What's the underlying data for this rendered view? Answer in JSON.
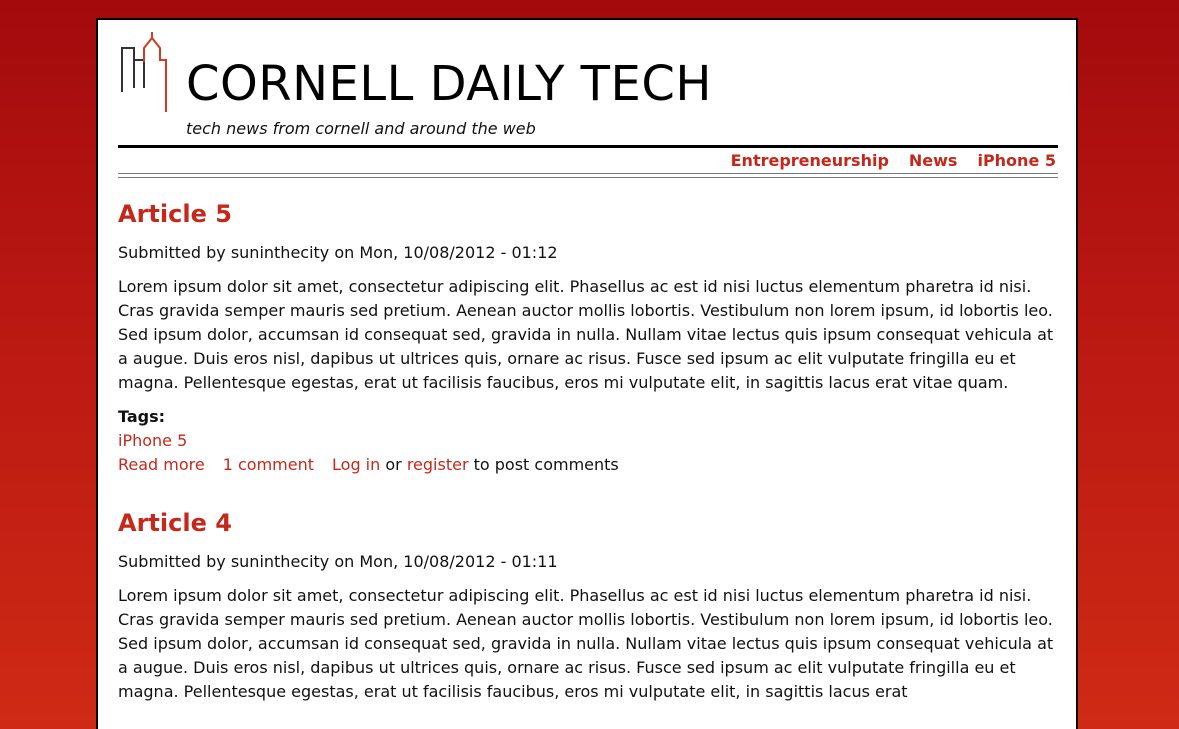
{
  "site": {
    "title": "CORNELL DAILY TECH",
    "slogan": "tech news from cornell and around the web",
    "logo_icon": "city-skyline-logo-icon"
  },
  "nav": {
    "items": [
      {
        "label": "Entrepreneurship"
      },
      {
        "label": "News"
      },
      {
        "label": "iPhone 5"
      }
    ]
  },
  "colors": {
    "accent": "#c5281a",
    "background_top": "#a30a0c",
    "background_bottom": "#cf2a15"
  },
  "articles": [
    {
      "title": "Article 5",
      "submitted": "Submitted by suninthecity on Mon, 10/08/2012 - 01:12",
      "body": "Lorem ipsum dolor sit amet, consectetur adipiscing elit. Phasellus ac est id nisi luctus elementum pharetra id nisi. Cras gravida semper mauris sed pretium. Aenean auctor mollis lobortis. Vestibulum non lorem ipsum, id lobortis leo. Sed ipsum dolor, accumsan id consequat sed, gravida in nulla. Nullam vitae lectus quis ipsum consequat vehicula at a augue. Duis eros nisl, dapibus ut ultrices quis, ornare ac risus. Fusce sed ipsum ac elit vulputate fringilla eu et magna. Pellentesque egestas, erat ut facilisis faucibus, eros mi vulputate elit, in sagittis lacus erat vitae quam.",
      "tags_label": "Tags:",
      "tag": "iPhone 5",
      "read_more": "Read more",
      "comments": "1 comment",
      "login": "Log in",
      "or_text": "or",
      "register": "register",
      "post_text": "to post comments"
    },
    {
      "title": "Article 4",
      "submitted": "Submitted by suninthecity on Mon, 10/08/2012 - 01:11",
      "body": "Lorem ipsum dolor sit amet, consectetur adipiscing elit. Phasellus ac est id nisi luctus elementum pharetra id nisi. Cras gravida semper mauris sed pretium. Aenean auctor mollis lobortis. Vestibulum non lorem ipsum, id lobortis leo. Sed ipsum dolor, accumsan id consequat sed, gravida in nulla. Nullam vitae lectus quis ipsum consequat vehicula at a augue. Duis eros nisl, dapibus ut ultrices quis, ornare ac risus. Fusce sed ipsum ac elit vulputate fringilla eu et magna. Pellentesque egestas, erat ut facilisis faucibus, eros mi vulputate elit, in sagittis lacus erat"
    }
  ]
}
